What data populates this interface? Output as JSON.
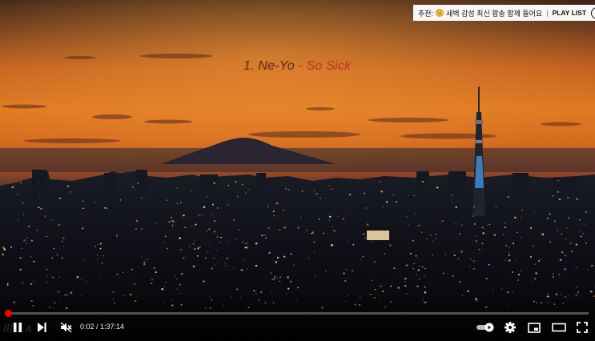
{
  "video": {
    "track_number": "1. Ne-Yo",
    "track_separator": " - ",
    "track_song": "So Sick"
  },
  "recommend_banner": {
    "prefix": "추천:",
    "emoji_icon": "smiling-face-icon",
    "text": "새벽 감성 최신 팝송 함께 들어요",
    "separator": "|",
    "playlist_label": "PLAY LIST",
    "info_icon": "info-icon"
  },
  "player": {
    "current_time": "0:02",
    "duration": "1:37:14",
    "time_display": "0:02 / 1:37:14",
    "progress_fraction": 0.0003,
    "accent_color": "#ff0000"
  },
  "controls": {
    "play_pause_icon": "pause-icon",
    "next_icon": "skip-next-icon",
    "volume_icon": "volume-muted-icon",
    "autoplay_icon": "autoplay-toggle-icon",
    "settings_icon": "gear-icon",
    "miniplayer_icon": "miniplayer-icon",
    "theater_icon": "theater-mode-icon",
    "fullscreen_icon": "fullscreen-icon"
  }
}
